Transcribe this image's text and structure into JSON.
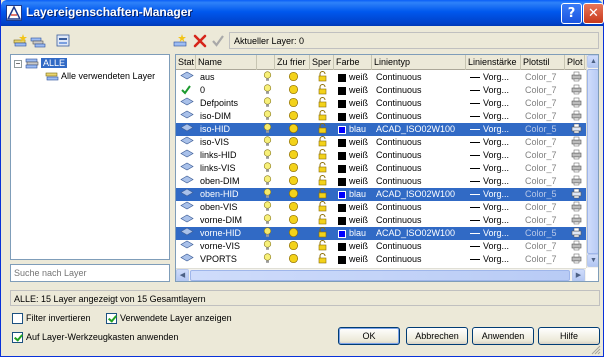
{
  "window": {
    "title": "Layereigenschaften-Manager",
    "help_glyph": "?",
    "close_glyph": "✕"
  },
  "toolbar": {
    "current_layer_label": "Aktueller Layer: 0"
  },
  "tree": {
    "root_label": "ALLE",
    "child_label": "Alle verwendeten Layer"
  },
  "search": {
    "placeholder": "Suche nach Layer"
  },
  "columns": {
    "status": "Stat",
    "name": "Name",
    "on": "",
    "freeze": "Zu frier",
    "lock": "Sper",
    "color": "Farbe",
    "linetype": "Linientyp",
    "lineweight": "Linienstärke",
    "plotstyle": "Plotstil",
    "plot": "Plot",
    "fr": "Fr"
  },
  "layers": [
    {
      "name": "aus",
      "color_name": "weiß",
      "color_hex": "#000000",
      "linetype": "Continuous",
      "lineweight": "Vorg...",
      "plotstyle": "Color_7",
      "selected": false,
      "current": false
    },
    {
      "name": "0",
      "color_name": "weiß",
      "color_hex": "#000000",
      "linetype": "Continuous",
      "lineweight": "Vorg...",
      "plotstyle": "Color_7",
      "selected": false,
      "current": true
    },
    {
      "name": "Defpoints",
      "color_name": "weiß",
      "color_hex": "#000000",
      "linetype": "Continuous",
      "lineweight": "Vorg...",
      "plotstyle": "Color_7",
      "selected": false,
      "current": false
    },
    {
      "name": "iso-DIM",
      "color_name": "weiß",
      "color_hex": "#000000",
      "linetype": "Continuous",
      "lineweight": "Vorg...",
      "plotstyle": "Color_7",
      "selected": false,
      "current": false
    },
    {
      "name": "iso-HID",
      "color_name": "blau",
      "color_hex": "#0000ff",
      "linetype": "ACAD_ISO02W100",
      "lineweight": "Vorg...",
      "plotstyle": "Color_5",
      "selected": true,
      "current": false
    },
    {
      "name": "iso-VIS",
      "color_name": "weiß",
      "color_hex": "#000000",
      "linetype": "Continuous",
      "lineweight": "Vorg...",
      "plotstyle": "Color_7",
      "selected": false,
      "current": false
    },
    {
      "name": "links-HID",
      "color_name": "weiß",
      "color_hex": "#000000",
      "linetype": "Continuous",
      "lineweight": "Vorg...",
      "plotstyle": "Color_7",
      "selected": false,
      "current": false
    },
    {
      "name": "links-VIS",
      "color_name": "weiß",
      "color_hex": "#000000",
      "linetype": "Continuous",
      "lineweight": "Vorg...",
      "plotstyle": "Color_7",
      "selected": false,
      "current": false
    },
    {
      "name": "oben-DIM",
      "color_name": "weiß",
      "color_hex": "#000000",
      "linetype": "Continuous",
      "lineweight": "Vorg...",
      "plotstyle": "Color_7",
      "selected": false,
      "current": false
    },
    {
      "name": "oben-HID",
      "color_name": "blau",
      "color_hex": "#0000ff",
      "linetype": "ACAD_ISO02W100",
      "lineweight": "Vorg...",
      "plotstyle": "Color_5",
      "selected": true,
      "current": false
    },
    {
      "name": "oben-VIS",
      "color_name": "weiß",
      "color_hex": "#000000",
      "linetype": "Continuous",
      "lineweight": "Vorg...",
      "plotstyle": "Color_7",
      "selected": false,
      "current": false
    },
    {
      "name": "vorne-DIM",
      "color_name": "weiß",
      "color_hex": "#000000",
      "linetype": "Continuous",
      "lineweight": "Vorg...",
      "plotstyle": "Color_7",
      "selected": false,
      "current": false
    },
    {
      "name": "vorne-HID",
      "color_name": "blau",
      "color_hex": "#0000ff",
      "linetype": "ACAD_ISO02W100",
      "lineweight": "Vorg...",
      "plotstyle": "Color_5",
      "selected": true,
      "current": false
    },
    {
      "name": "vorne-VIS",
      "color_name": "weiß",
      "color_hex": "#000000",
      "linetype": "Continuous",
      "lineweight": "Vorg...",
      "plotstyle": "Color_7",
      "selected": false,
      "current": false
    },
    {
      "name": "VPORTS",
      "color_name": "weiß",
      "color_hex": "#000000",
      "linetype": "Continuous",
      "lineweight": "Vorg...",
      "plotstyle": "Color_7",
      "selected": false,
      "current": false
    }
  ],
  "status": {
    "text": "ALLE: 15 Layer angezeigt von 15 Gesamtlayern"
  },
  "options": {
    "invert_filter": "Filter invertieren",
    "invert_filter_checked": false,
    "show_used": "Verwendete Layer anzeigen",
    "show_used_checked": true,
    "apply_toolbar": "Auf Layer-Werkzeugkasten anwenden",
    "apply_toolbar_checked": true
  },
  "buttons": {
    "ok": "OK",
    "cancel": "Abbrechen",
    "apply": "Anwenden",
    "help": "Hilfe"
  },
  "colors": {
    "selection": "#316ac5",
    "title_bar": "#0058ee",
    "dialog_bg": "#ece9d8"
  }
}
